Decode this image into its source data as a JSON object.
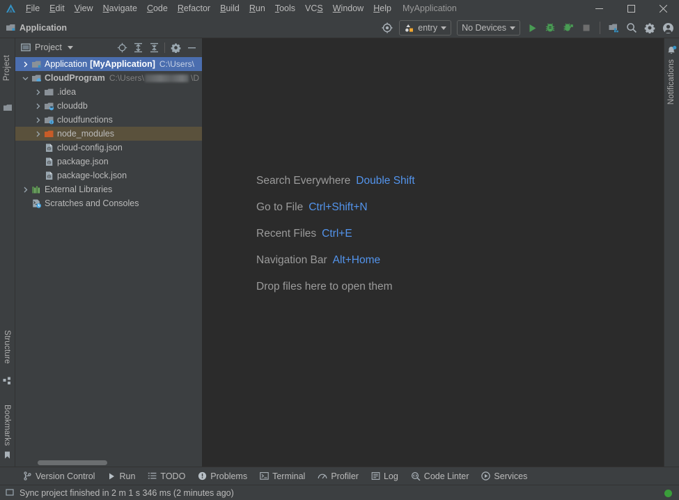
{
  "window": {
    "title": "MyApplication",
    "controls": [
      {
        "name": "minimize",
        "glyph": "—"
      },
      {
        "name": "maximize",
        "glyph": "☐"
      },
      {
        "name": "close",
        "glyph": "✕"
      }
    ]
  },
  "menubar": {
    "logo_icon": "app-logo-icon",
    "items": [
      {
        "label": "File",
        "mnemonic": "F"
      },
      {
        "label": "Edit",
        "mnemonic": "E"
      },
      {
        "label": "View",
        "mnemonic": "V"
      },
      {
        "label": "Navigate",
        "mnemonic": "N"
      },
      {
        "label": "Code",
        "mnemonic": "C"
      },
      {
        "label": "Refactor",
        "mnemonic": "R"
      },
      {
        "label": "Build",
        "mnemonic": "B"
      },
      {
        "label": "Run",
        "mnemonic": "R"
      },
      {
        "label": "Tools",
        "mnemonic": "T"
      },
      {
        "label": "VCS",
        "mnemonic": "S"
      },
      {
        "label": "Window",
        "mnemonic": "W"
      },
      {
        "label": "Help",
        "mnemonic": "H"
      }
    ]
  },
  "navbar": {
    "breadcrumb": "Application",
    "breadcrumb_icon": "module-icon",
    "target_icon": "select-target-icon",
    "run_config": {
      "label": "entry",
      "icon": "entry-config-icon"
    },
    "device": {
      "label": "No Devices"
    },
    "actions": [
      {
        "name": "run-button",
        "icon": "run-icon",
        "color": "#499c54"
      },
      {
        "name": "debug-button",
        "icon": "debug-icon",
        "color": "#499c54"
      },
      {
        "name": "attach-debugger-button",
        "icon": "attach-debug-icon",
        "color": "#499c54"
      },
      {
        "name": "stop-button",
        "icon": "stop-icon",
        "color": "#6e6e6e"
      },
      {
        "name": "project-structure-button",
        "icon": "project-structure-icon",
        "color": "#9aa7b0"
      },
      {
        "name": "search-button",
        "icon": "search-icon",
        "color": "#9aa7b0"
      },
      {
        "name": "settings-button",
        "icon": "gear-icon",
        "color": "#9aa7b0"
      },
      {
        "name": "account-button",
        "icon": "account-icon",
        "color": "#9aa7b0"
      }
    ]
  },
  "left_stripe": {
    "top": [
      {
        "label": "Project",
        "icon": "project-tool-icon"
      }
    ],
    "bottom": [
      {
        "label": "Structure",
        "icon": "structure-tool-icon"
      },
      {
        "label": "Bookmarks",
        "icon": "bookmarks-tool-icon"
      }
    ]
  },
  "right_stripe": {
    "items": [
      {
        "label": "Notifications",
        "icon": "notifications-bell-icon"
      }
    ]
  },
  "project_panel": {
    "title": "Project",
    "title_icon": "project-view-icon",
    "dropdown_icon": "chevron-down-icon",
    "header_actions": [
      {
        "name": "select-opened-file-button",
        "icon": "crosshair-icon"
      },
      {
        "name": "expand-all-button",
        "icon": "expand-all-icon"
      },
      {
        "name": "collapse-all-button",
        "icon": "collapse-all-icon"
      },
      {
        "name": "options-button",
        "icon": "gear-icon"
      },
      {
        "name": "hide-button",
        "icon": "minimize-icon"
      }
    ],
    "tree": [
      {
        "label": "Application",
        "bold_label": "[MyApplication]",
        "path": "C:\\Users\\",
        "indent": 0,
        "arrow": "collapsed",
        "icon": "module-icon",
        "state": "selected",
        "blurred": false
      },
      {
        "label": "CloudProgram",
        "bold": true,
        "path": "C:\\Users\\",
        "path_suffix": "\\D",
        "indent": 0,
        "arrow": "expanded",
        "icon": "cloud-module-icon",
        "state": "normal",
        "blurred": true
      },
      {
        "label": ".idea",
        "indent": 1,
        "arrow": "collapsed",
        "icon": "folder-icon",
        "state": "normal"
      },
      {
        "label": "clouddb",
        "indent": 1,
        "arrow": "collapsed",
        "icon": "folder-db-icon",
        "state": "normal"
      },
      {
        "label": "cloudfunctions",
        "indent": 1,
        "arrow": "collapsed",
        "icon": "folder-fn-icon",
        "state": "normal"
      },
      {
        "label": "node_modules",
        "indent": 1,
        "arrow": "collapsed",
        "icon": "folder-excluded-icon",
        "state": "highlighted"
      },
      {
        "label": "cloud-config.json",
        "indent": 1,
        "arrow": "none",
        "icon": "json-file-icon",
        "state": "normal"
      },
      {
        "label": "package.json",
        "indent": 1,
        "arrow": "none",
        "icon": "json-file-icon",
        "state": "normal"
      },
      {
        "label": "package-lock.json",
        "indent": 1,
        "arrow": "none",
        "icon": "json-file-icon",
        "state": "normal"
      },
      {
        "label": "External Libraries",
        "indent": 0,
        "arrow": "collapsed",
        "icon": "libraries-icon",
        "state": "normal"
      },
      {
        "label": "Scratches and Consoles",
        "indent": 0,
        "arrow": "none",
        "icon": "scratches-icon",
        "state": "normal"
      }
    ]
  },
  "editor": {
    "tips": [
      {
        "action": "Search Everywhere",
        "shortcut": "Double Shift"
      },
      {
        "action": "Go to File",
        "shortcut": "Ctrl+Shift+N"
      },
      {
        "action": "Recent Files",
        "shortcut": "Ctrl+E"
      },
      {
        "action": "Navigation Bar",
        "shortcut": "Alt+Home"
      },
      {
        "action": "Drop files here to open them",
        "shortcut": ""
      }
    ],
    "shortcut_color": "#5394ec"
  },
  "tool_window_bar": {
    "items": [
      {
        "label": "Version Control",
        "icon": "branch-icon"
      },
      {
        "label": "Run",
        "icon": "run-icon"
      },
      {
        "label": "TODO",
        "icon": "todo-list-icon"
      },
      {
        "label": "Problems",
        "icon": "problems-icon"
      },
      {
        "label": "Terminal",
        "icon": "terminal-icon"
      },
      {
        "label": "Profiler",
        "icon": "profiler-icon"
      },
      {
        "label": "Log",
        "icon": "log-icon"
      },
      {
        "label": "Code Linter",
        "icon": "code-linter-icon"
      },
      {
        "label": "Services",
        "icon": "services-icon"
      }
    ]
  },
  "statusbar": {
    "icon": "event-log-icon",
    "message": "Sync project finished in 2 m 1 s 346 ms (2 minutes ago)",
    "indicator_color": "#3a9e3a"
  }
}
